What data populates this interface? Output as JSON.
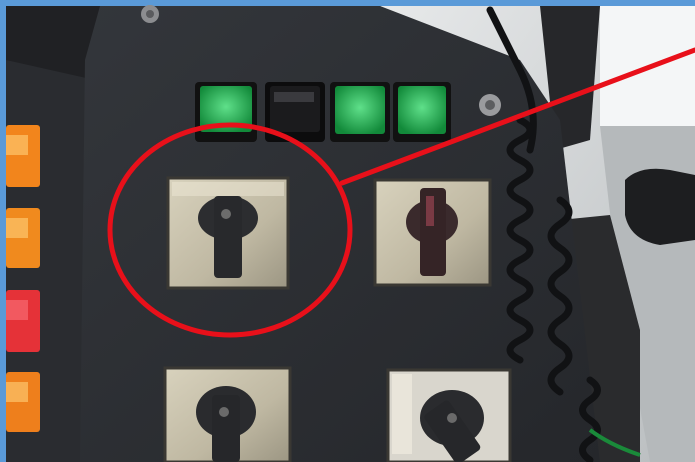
{
  "image": {
    "subject": "control-panel-photo",
    "frame_color": "#5a9ad8",
    "annotation_color": "#e8101a"
  },
  "panel": {
    "color": "#2b2d31",
    "push_buttons": [
      {
        "name": "green",
        "color": "#1faa4a",
        "lit": true
      },
      {
        "name": "black",
        "color": "#1b1b1d",
        "lit": false
      },
      {
        "name": "green",
        "color": "#1c9c42",
        "lit": true
      },
      {
        "name": "green",
        "color": "#1ea849",
        "lit": true
      }
    ],
    "side_indicators": [
      {
        "name": "orange",
        "color": "#f2851c"
      },
      {
        "name": "orange",
        "color": "#f08a1e"
      },
      {
        "name": "red",
        "color": "#e53238"
      },
      {
        "name": "orange",
        "color": "#ee7f1c"
      }
    ],
    "rotary_switches": [
      {
        "name": "highlighted-rotary-switch",
        "highlighted": true
      },
      {
        "name": "rotary-switch-right",
        "highlighted": false
      },
      {
        "name": "rotary-switch-bottom-left",
        "highlighted": false
      },
      {
        "name": "rotary-switch-bottom-right",
        "highlighted": false
      }
    ]
  }
}
